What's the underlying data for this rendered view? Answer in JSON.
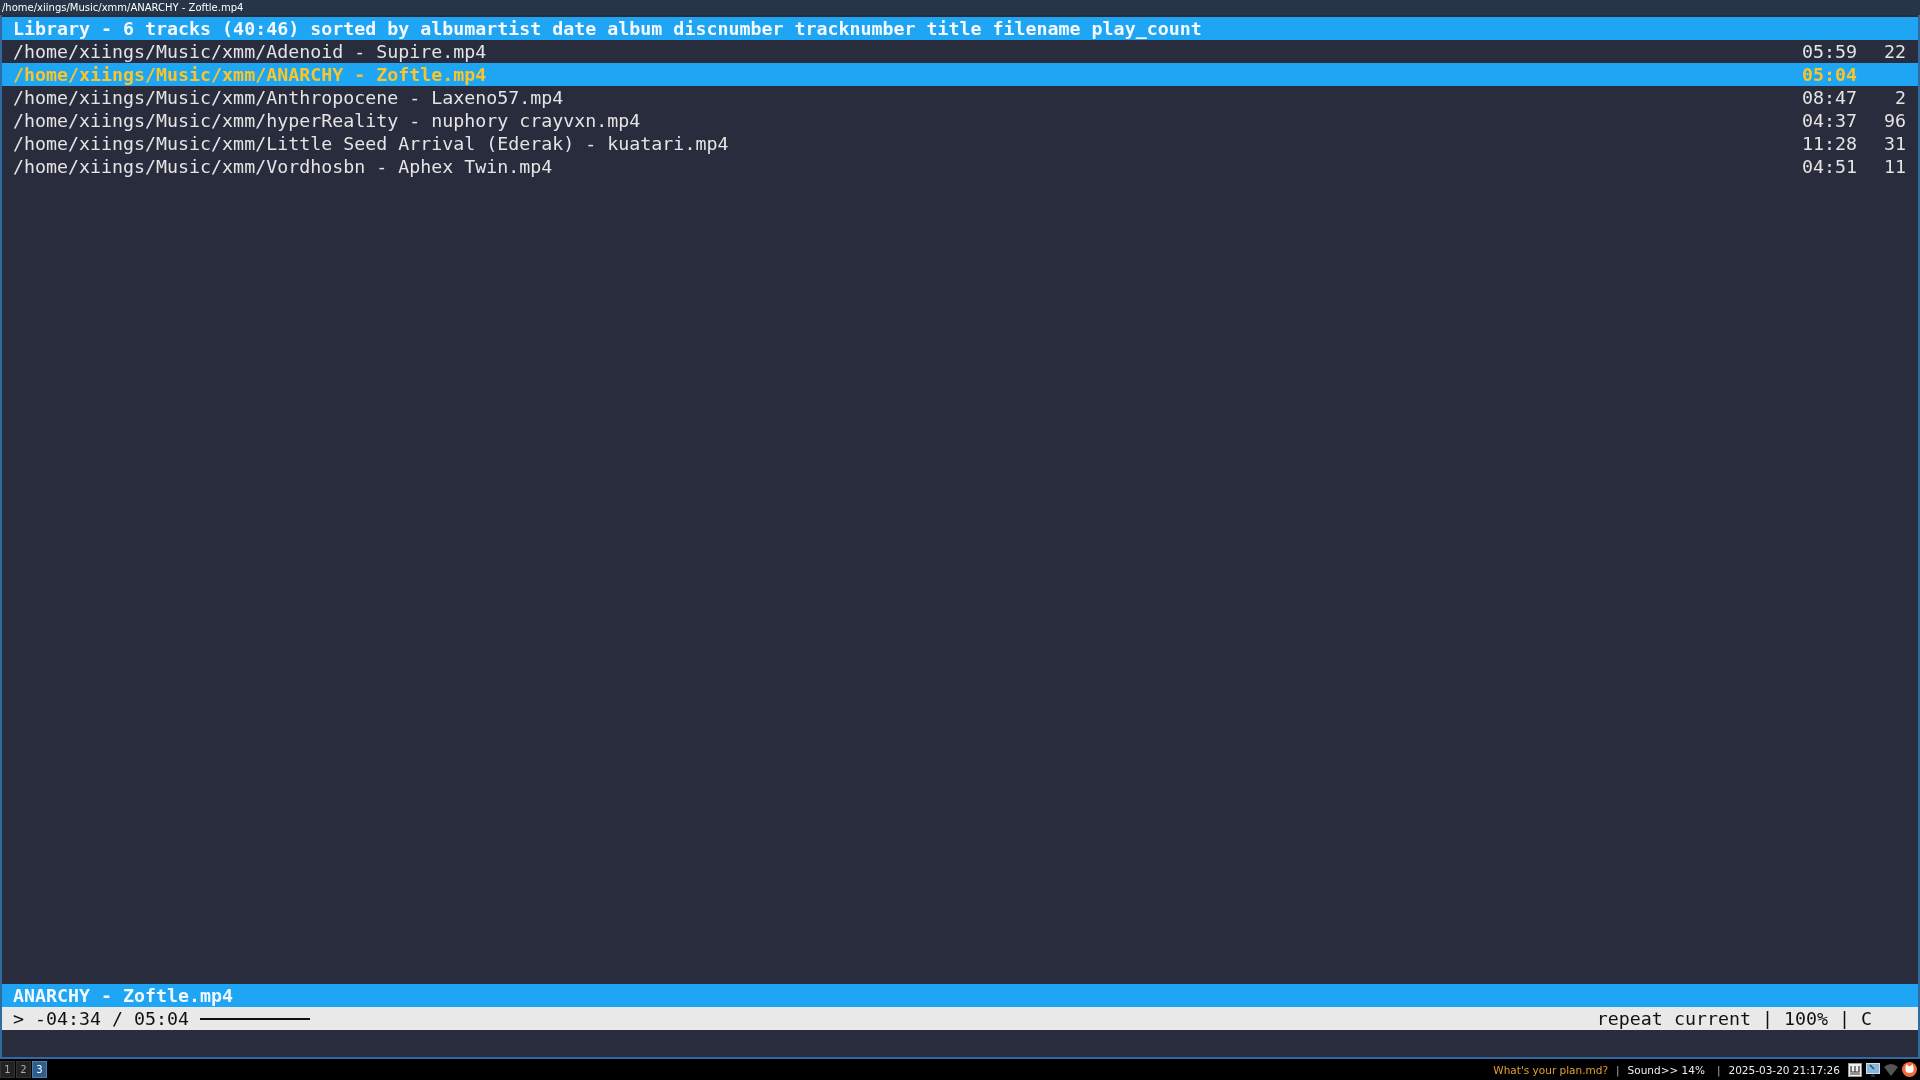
{
  "window": {
    "title": "/home/xiings/Music/xmm/ANARCHY - Zoftle.mp4"
  },
  "library": {
    "header": "Library - 6 tracks (40:46) sorted by albumartist date album discnumber tracknumber title filename play_count",
    "tracks": [
      {
        "path": "/home/xiings/Music/xmm/Adenoid - Supire.mp4",
        "duration": "05:59",
        "play_count": "22",
        "selected": false
      },
      {
        "path": "/home/xiings/Music/xmm/ANARCHY - Zoftle.mp4",
        "duration": "05:04",
        "selected": true
      },
      {
        "path": "/home/xiings/Music/xmm/Anthropocene - Laxeno57.mp4",
        "duration": "08:47",
        "play_count": "2",
        "selected": false
      },
      {
        "path": "/home/xiings/Music/xmm/hyperReality - nuphory crayvxn.mp4",
        "duration": "04:37",
        "play_count": "96",
        "selected": false
      },
      {
        "path": "/home/xiings/Music/xmm/Little Seed Arrival (Ederak) - kuatari.mp4",
        "duration": "11:28",
        "play_count": "31",
        "selected": false
      },
      {
        "path": "/home/xiings/Music/xmm/Vordhosbn - Aphex Twin.mp4",
        "duration": "04:51",
        "play_count": "11",
        "selected": false
      }
    ]
  },
  "now_playing": {
    "title": "ANARCHY - Zoftle.mp4",
    "status": ">",
    "position": "-04:34 / 05:04",
    "mode": "repeat current | 100% | C"
  },
  "taskbar": {
    "workspaces": [
      {
        "label": "1",
        "selected": false
      },
      {
        "label": "2",
        "selected": false
      },
      {
        "label": "3",
        "selected": true
      }
    ],
    "status": [
      {
        "kind": "note",
        "text": "What's your plan.md?"
      },
      {
        "kind": "sep",
        "text": "|"
      },
      {
        "kind": "text",
        "text": "Sound>> 14%"
      },
      {
        "kind": "sep",
        "text": "|"
      },
      {
        "kind": "text",
        "text": "2025-03-20 21:17:26"
      }
    ]
  }
}
